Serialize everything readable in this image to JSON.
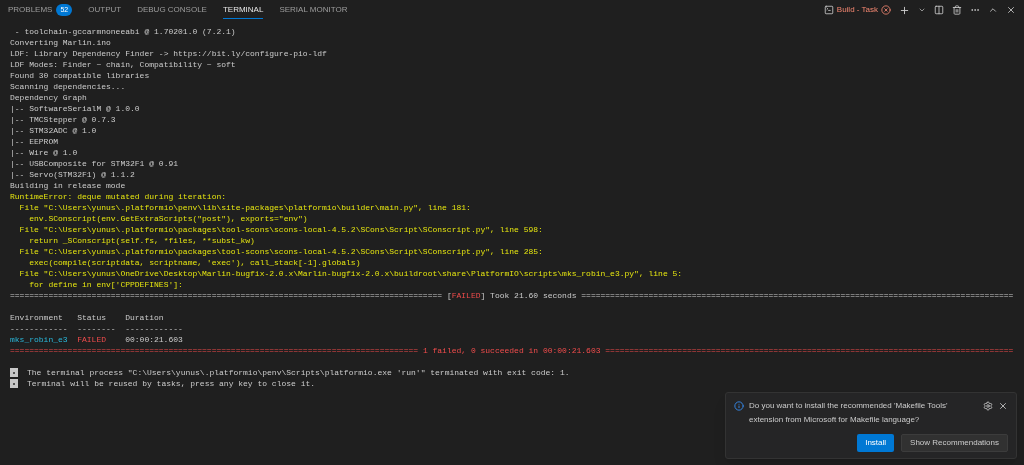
{
  "panel_tabs": [
    {
      "label": "PROBLEMS",
      "badge": "52",
      "selected": false
    },
    {
      "label": "OUTPUT",
      "selected": false
    },
    {
      "label": "DEBUG CONSOLE",
      "selected": false
    },
    {
      "label": "TERMINAL",
      "selected": true
    },
    {
      "label": "SERIAL MONITOR",
      "selected": false
    }
  ],
  "terminal_selector": {
    "label": "Build - Task",
    "failed": true
  },
  "terminal": {
    "log": [
      {
        "kind": "text",
        "warning": false,
        "text": " - toolchain-gccarmnoneeabi @ 1.70201.0 (7.2.1)"
      },
      {
        "kind": "text",
        "warning": false,
        "text": "Converting Marlin.ino"
      },
      {
        "kind": "text",
        "warning": false,
        "text": "LDF: Library Dependency Finder -> https://bit.ly/configure-pio-ldf"
      },
      {
        "kind": "text",
        "warning": false,
        "text": "LDF Modes: Finder ~ chain, Compatibility ~ soft"
      },
      {
        "kind": "text",
        "warning": false,
        "text": "Found 30 compatible libraries"
      },
      {
        "kind": "text",
        "warning": false,
        "text": "Scanning dependencies..."
      },
      {
        "kind": "text",
        "warning": false,
        "text": "Dependency Graph"
      },
      {
        "kind": "text",
        "warning": false,
        "text": "|-- SoftwareSerialM @ 1.0.0"
      },
      {
        "kind": "text",
        "warning": false,
        "text": "|-- TMCStepper @ 0.7.3"
      },
      {
        "kind": "text",
        "warning": false,
        "text": "|-- STM32ADC @ 1.0"
      },
      {
        "kind": "text",
        "warning": false,
        "text": "|-- EEPROM"
      },
      {
        "kind": "text",
        "warning": false,
        "text": "|-- Wire @ 1.0"
      },
      {
        "kind": "text",
        "warning": false,
        "text": "|-- USBComposite for STM32F1 @ 0.91"
      },
      {
        "kind": "text",
        "warning": false,
        "text": "|-- Servo(STM32F1) @ 1.1.2"
      },
      {
        "kind": "text",
        "warning": false,
        "text": "Building in release mode"
      },
      {
        "kind": "text",
        "warning": true,
        "text": "RuntimeError: deque mutated during iteration:"
      },
      {
        "kind": "text",
        "warning": true,
        "text": "  File \"C:\\Users\\yunus\\.platformio\\penv\\lib\\site-packages\\platformio\\builder\\main.py\", line 181:"
      },
      {
        "kind": "text",
        "warning": true,
        "text": "    env.SConscript(env.GetExtraScripts(\"post\"), exports=\"env\")"
      },
      {
        "kind": "text",
        "warning": true,
        "text": "  File \"C:\\Users\\yunus\\.platformio\\packages\\tool-scons\\scons-local-4.5.2\\SCons\\Script\\SConscript.py\", line 598:"
      },
      {
        "kind": "text",
        "warning": true,
        "text": "    return _SConscript(self.fs, *files, **subst_kw)"
      },
      {
        "kind": "text",
        "warning": true,
        "text": "  File \"C:\\Users\\yunus\\.platformio\\packages\\tool-scons\\scons-local-4.5.2\\SCons\\Script\\SConscript.py\", line 285:"
      },
      {
        "kind": "text",
        "warning": true,
        "text": "    exec(compile(scriptdata, scriptname, 'exec'), call_stack[-1].globals)"
      },
      {
        "kind": "text",
        "warning": true,
        "text": "  File \"C:\\Users\\yunus\\OneDrive\\Desktop\\Marlin-bugfix-2.0.x\\Marlin-bugfix-2.0.x\\buildroot\\share\\PlatformIO\\scripts\\mks_robin_e3.py\", line 5:"
      },
      {
        "kind": "text",
        "warning": true,
        "text": "    for define in env['CPPDEFINES']:"
      },
      {
        "kind": "banner",
        "failed": false,
        "rule_left": "==========================================================================================",
        "parts": [
          {
            "text": "[",
            "failed": false
          },
          {
            "text": "FAILED",
            "failed": true
          },
          {
            "text": "] Took 21.60 seconds",
            "failed": false
          }
        ],
        "rule_right": "=========================================================================================="
      },
      {
        "kind": "blank"
      }
    ],
    "summary": {
      "columns": [
        "Environment",
        "Status",
        "Duration"
      ],
      "rules": [
        "------------",
        "--------",
        "------------"
      ],
      "rows": [
        {
          "environment": "mks_robin_e3",
          "status": "FAILED",
          "failed": true,
          "duration": "00:00:21.603"
        }
      ]
    },
    "result_banner": {
      "failed": true,
      "rule_left": "=====================================================================================",
      "parts": [
        {
          "text": "1 failed, 0 succeeded in 00:00:21.603",
          "failed": true
        }
      ],
      "rule_right": "====================================================================================="
    },
    "messages": [
      "The terminal process \"C:\\Users\\yunus\\.platformio\\penv\\Scripts\\platformio.exe 'run'\" terminated with exit code: 1.",
      "Terminal will be reused by tasks, press any key to close it."
    ]
  },
  "notification": {
    "message": "Do you want to install the recommended 'Makefile Tools' extension from Microsoft for Makefile language?",
    "buttons": [
      {
        "label": "Install",
        "primary": true
      },
      {
        "label": "Show Recommendations",
        "primary": false
      }
    ]
  }
}
